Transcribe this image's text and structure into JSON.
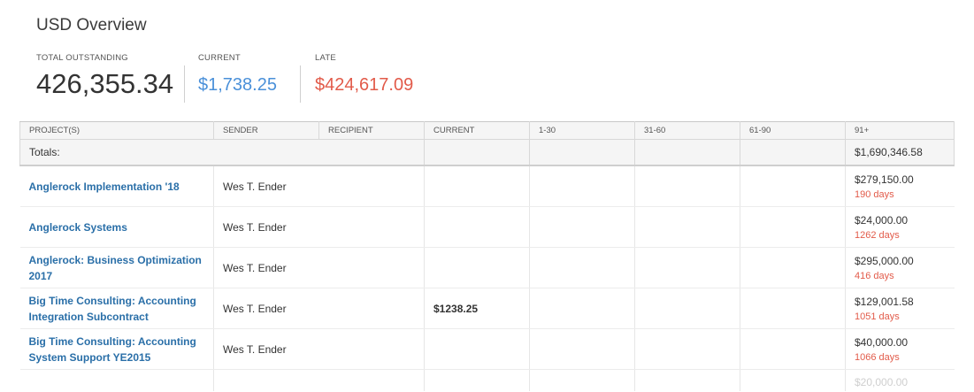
{
  "overview": {
    "title": "USD Overview",
    "total_label": "TOTAL OUTSTANDING",
    "total_value": "426,355.34",
    "current_label": "CURRENT",
    "current_value": "$1,738.25",
    "late_label": "LATE",
    "late_value": "$424,617.09"
  },
  "colors": {
    "current": "#4a90d9",
    "late": "#e25b4a",
    "link": "#2a6fa8"
  },
  "table": {
    "headers": [
      "PROJECT(S)",
      "SENDER",
      "RECIPIENT",
      "CURRENT",
      "1-30",
      "31-60",
      "61-90",
      "91+"
    ],
    "totals_label": "Totals:",
    "totals_91": "$1,690,346.58",
    "rows": [
      {
        "project": "Anglerock Implementation '18",
        "sender": "Wes T. Ender",
        "recipient": "",
        "current": "",
        "d1_30": "",
        "d31_60": "",
        "d61_90": "",
        "d91_amount": "$279,150.00",
        "d91_days": "190 days"
      },
      {
        "project": "Anglerock Systems",
        "sender": "Wes T. Ender",
        "recipient": "",
        "current": "",
        "d1_30": "",
        "d31_60": "",
        "d61_90": "",
        "d91_amount": "$24,000.00",
        "d91_days": "1262 days"
      },
      {
        "project": "Anglerock: Business Optimization 2017",
        "sender": "Wes T. Ender",
        "recipient": "",
        "current": "",
        "d1_30": "",
        "d31_60": "",
        "d61_90": "",
        "d91_amount": "$295,000.00",
        "d91_days": "416 days"
      },
      {
        "project": "Big Time Consulting: Accounting Integration Subcontract",
        "sender": "Wes T. Ender",
        "recipient": "",
        "current": "$1238.25",
        "d1_30": "",
        "d31_60": "",
        "d61_90": "",
        "d91_amount": "$129,001.58",
        "d91_days": "1051 days"
      },
      {
        "project": "Big Time Consulting: Accounting System Support YE2015",
        "sender": "Wes T. Ender",
        "recipient": "",
        "current": "",
        "d1_30": "",
        "d31_60": "",
        "d61_90": "",
        "d91_amount": "$40,000.00",
        "d91_days": "1066 days"
      }
    ],
    "partial_row_amount": "$20,000.00"
  }
}
